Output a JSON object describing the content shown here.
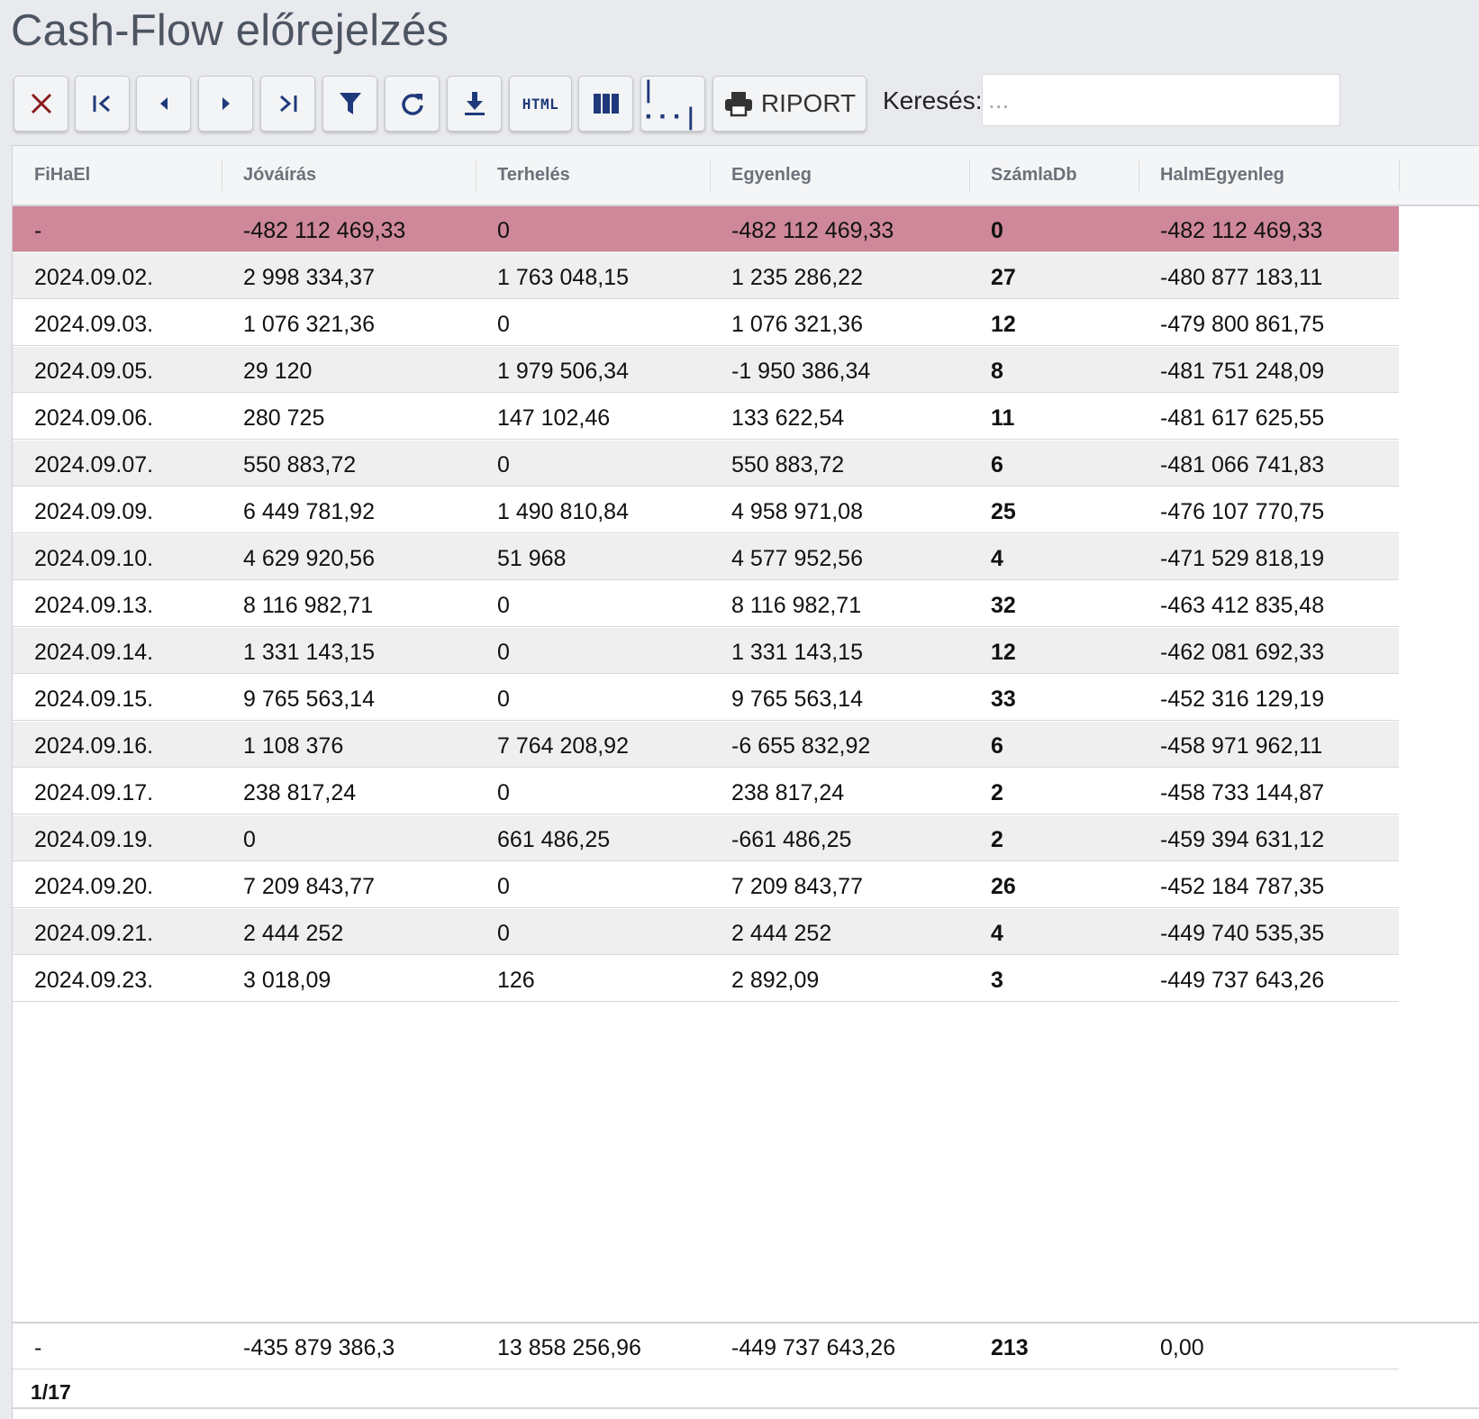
{
  "page_title": "Cash-Flow előrejelzés",
  "toolbar": {
    "buttons": [
      {
        "icon": "close-icon",
        "label": ""
      },
      {
        "icon": "first-page-icon",
        "label": ""
      },
      {
        "icon": "previous-icon",
        "label": ""
      },
      {
        "icon": "next-icon",
        "label": ""
      },
      {
        "icon": "last-page-icon",
        "label": ""
      },
      {
        "icon": "filter-icon",
        "label": ""
      },
      {
        "icon": "refresh-icon",
        "label": ""
      },
      {
        "icon": "download-icon",
        "label": ""
      },
      {
        "icon": "html-export-icon",
        "label": "HTML"
      },
      {
        "icon": "columns-icon",
        "label": ""
      },
      {
        "icon": "column-width-icon",
        "label": "|···|"
      },
      {
        "icon": "print-icon",
        "label": "RIPORT"
      }
    ],
    "close_color": "#8a1a1a",
    "icon_color": "#1f3a7a"
  },
  "search": {
    "label": "Keresés:",
    "placeholder": "...",
    "value": ""
  },
  "table": {
    "columns": [
      "FiHaEl",
      "Jóváírás",
      "Terhelés",
      "Egyenleg",
      "SzámlaDb",
      "HalmEgyenleg"
    ],
    "highlight_color": "#ce8899",
    "rows": [
      [
        "-",
        "-482 112 469,33",
        "0",
        "-482 112 469,33",
        "0",
        "-482 112 469,33"
      ],
      [
        "2024.09.02.",
        "2 998 334,37",
        "1 763 048,15",
        "1 235 286,22",
        "27",
        "-480 877 183,11"
      ],
      [
        "2024.09.03.",
        "1 076 321,36",
        "0",
        "1 076 321,36",
        "12",
        "-479 800 861,75"
      ],
      [
        "2024.09.05.",
        "29 120",
        "1 979 506,34",
        "-1 950 386,34",
        "8",
        "-481 751 248,09"
      ],
      [
        "2024.09.06.",
        "280 725",
        "147 102,46",
        "133 622,54",
        "11",
        "-481 617 625,55"
      ],
      [
        "2024.09.07.",
        "550 883,72",
        "0",
        "550 883,72",
        "6",
        "-481 066 741,83"
      ],
      [
        "2024.09.09.",
        "6 449 781,92",
        "1 490 810,84",
        "4 958 971,08",
        "25",
        "-476 107 770,75"
      ],
      [
        "2024.09.10.",
        "4 629 920,56",
        "51 968",
        "4 577 952,56",
        "4",
        "-471 529 818,19"
      ],
      [
        "2024.09.13.",
        "8 116 982,71",
        "0",
        "8 116 982,71",
        "32",
        "-463 412 835,48"
      ],
      [
        "2024.09.14.",
        "1 331 143,15",
        "0",
        "1 331 143,15",
        "12",
        "-462 081 692,33"
      ],
      [
        "2024.09.15.",
        "9 765 563,14",
        "0",
        "9 765 563,14",
        "33",
        "-452 316 129,19"
      ],
      [
        "2024.09.16.",
        "1 108 376",
        "7 764 208,92",
        "-6 655 832,92",
        "6",
        "-458 971 962,11"
      ],
      [
        "2024.09.17.",
        "238 817,24",
        "0",
        "238 817,24",
        "2",
        "-458 733 144,87"
      ],
      [
        "2024.09.19.",
        "0",
        "661 486,25",
        "-661 486,25",
        "2",
        "-459 394 631,12"
      ],
      [
        "2024.09.20.",
        "7 209 843,77",
        "0",
        "7 209 843,77",
        "26",
        "-452 184 787,35"
      ],
      [
        "2024.09.21.",
        "2 444 252",
        "0",
        "2 444 252",
        "4",
        "-449 740 535,35"
      ],
      [
        "2024.09.23.",
        "3 018,09",
        "126",
        "2 892,09",
        "3",
        "-449 737 643,26"
      ]
    ],
    "summary": [
      "-",
      "-435 879 386,3",
      "13 858 256,96",
      "-449 737 643,26",
      "213",
      "0,00"
    ]
  },
  "pager": {
    "text": "1/17"
  }
}
